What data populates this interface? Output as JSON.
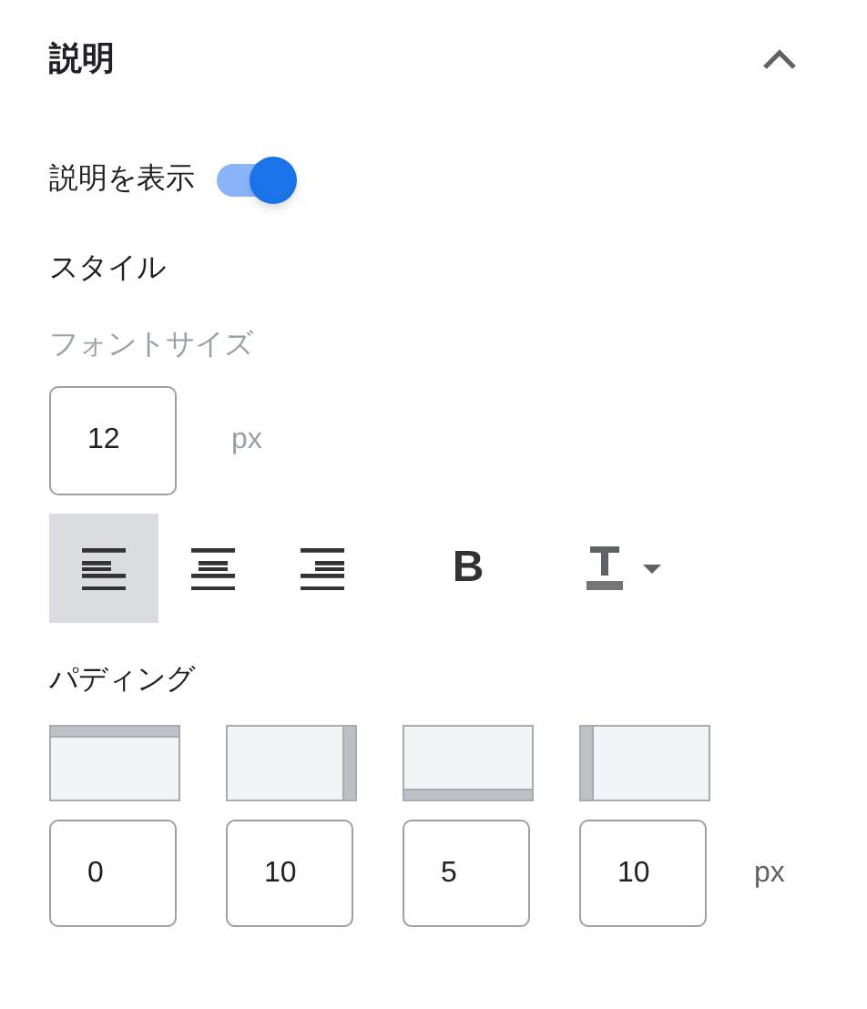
{
  "section": {
    "title": "説明",
    "expanded": true
  },
  "toggle": {
    "label": "説明を表示",
    "on": true
  },
  "style_heading": "スタイル",
  "font_size": {
    "label": "フォントサイズ",
    "value": "12",
    "unit": "px"
  },
  "format_buttons": [
    {
      "kind": "align-left",
      "selected": true
    },
    {
      "kind": "align-center",
      "selected": false
    },
    {
      "kind": "align-right",
      "selected": false
    },
    {
      "kind": "bold",
      "label": "B",
      "selected": false
    },
    {
      "kind": "text-color",
      "selected": false
    }
  ],
  "padding": {
    "label": "パディング",
    "unit": "px",
    "sides": [
      {
        "kind": "top",
        "value": "0"
      },
      {
        "kind": "right",
        "value": "10"
      },
      {
        "kind": "bottom",
        "value": "5"
      },
      {
        "kind": "left",
        "value": "10"
      }
    ]
  }
}
